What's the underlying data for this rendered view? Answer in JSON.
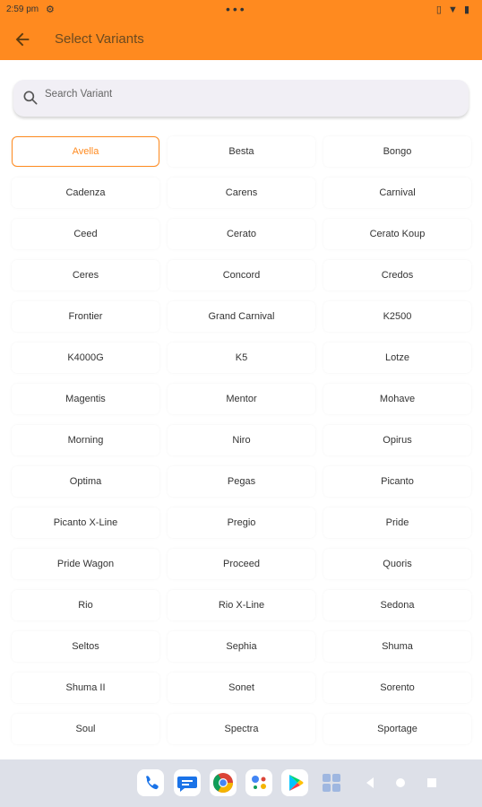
{
  "status": {
    "time": "2:59 pm",
    "dots": "•••"
  },
  "appbar": {
    "title": "Select Variants"
  },
  "search": {
    "placeholder": "Search Variant"
  },
  "variants": [
    "Avella",
    "Besta",
    "Bongo",
    "Cadenza",
    "Carens",
    "Carnival",
    "Ceed",
    "Cerato",
    "Cerato Koup",
    "Ceres",
    "Concord",
    "Credos",
    "Frontier",
    "Grand Carnival",
    "K2500",
    "K4000G",
    "K5",
    "Lotze",
    "Magentis",
    "Mentor",
    "Mohave",
    "Morning",
    "Niro",
    "Opirus",
    "Optima",
    "Pegas",
    "Picanto",
    "Picanto X-Line",
    "Pregio",
    "Pride",
    "Pride Wagon",
    "Proceed",
    "Quoris",
    "Rio",
    "Rio X-Line",
    "Sedona",
    "Seltos",
    "Sephia",
    "Shuma",
    "Shuma II",
    "Sonet",
    "Sorento",
    "Soul",
    "Spectra",
    "Sportage"
  ],
  "selected_variant": "Avella",
  "colors": {
    "accent": "#FF8A1F",
    "navbar": "#dde0e8"
  },
  "dock_icons": [
    "phone-icon",
    "messages-icon",
    "chrome-icon",
    "assistant-icon",
    "play-store-icon",
    "app-drawer-icon"
  ],
  "nav_controls": [
    "back-icon",
    "home-icon",
    "recents-icon"
  ]
}
